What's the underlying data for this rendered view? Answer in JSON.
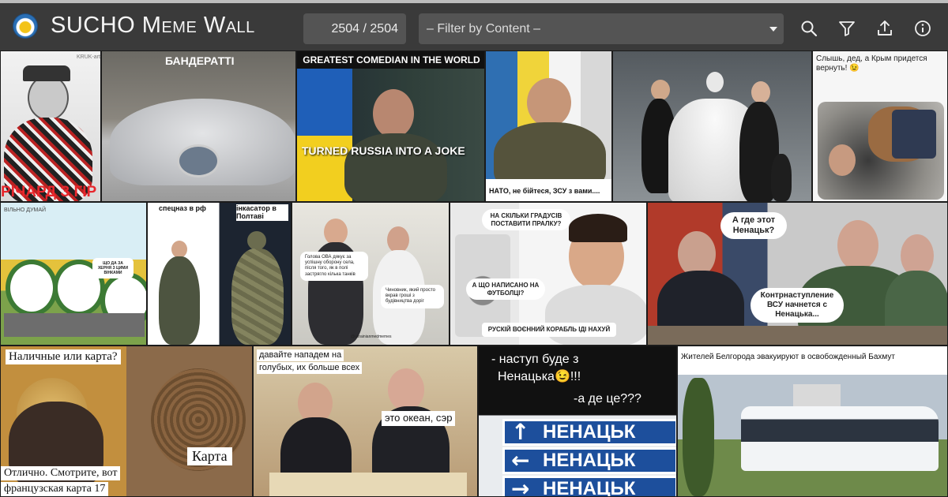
{
  "app": {
    "title": "SUCHO Meme Wall",
    "counter": "2504 / 2504",
    "filter_placeholder": "– Filter by Content –"
  },
  "toolbar": {
    "icons": [
      "search-icon",
      "filter-icon",
      "share-icon",
      "info-icon"
    ]
  },
  "memes": {
    "m1": {
      "caption": "РІЧАРД З ГІР",
      "watermark": "KRUK-art"
    },
    "m2": {
      "caption": "БАНДЕРАТТІ"
    },
    "m3": {
      "top": "GREATEST COMEDIAN IN THE WORLD",
      "bottom": "TURNED RUSSIA INTO A JOKE"
    },
    "m4": {
      "caption": "НАТО, не бійтеся, ЗСУ з вами...."
    },
    "m6": {
      "caption": "Слышь, дед, а Крым придется вернуть! 😉"
    },
    "m7": {
      "bubble": "ЩО ДА ЗА ХЕРНЯ З ЦИМИ ВІНКАМИ",
      "tag": "ВІЛЬНО ДУМАЙ"
    },
    "m8": {
      "left": "спецназ в рф",
      "right": "інкасатор в Полтаві"
    },
    "m9": {
      "bubble1": "Голова ОВА дякує за успішну оборону села, після того, як в полі застрягло кілька танків",
      "bubble2": "Чиновник, який просто вкрав гроші з будівництва доріг",
      "footer": "@ukrainianmedmemes"
    },
    "m10": {
      "bubble1": "НА СКІЛЬКИ ГРАДУСІВ ПОСТАВИТИ ПРАЛКУ?",
      "bubble2": "А ЩО НАПИСАНО НА ФУТБОЛЦІ?",
      "bubble3": "РУСКІЙ ВОЄННИЙ КОРАБЛЬ ІДІ НАХУЙ"
    },
    "m11": {
      "bubble1": "А где этот Ненацьк?",
      "bubble2": "Контрнаступление ВСУ начнется с Ненацька..."
    },
    "m12": {
      "top": "Наличные или карта?",
      "middle": "Карта",
      "bottom1": "Отлично. Смотрите, вот",
      "bottom2": "французская карта 17"
    },
    "m13": {
      "top1": "давайте нападем на",
      "top2": "голубых, их больше всех",
      "right": "это океан, сэр"
    },
    "m14": {
      "line1": "- наступ буде з",
      "line2": "Ненацька😉!!!",
      "line3": "-а де це???",
      "sign1": "НЕНАЦЬК",
      "sign2": "НЕНАЦЬК",
      "sign3": "НЕНАЦЬК"
    },
    "m15": {
      "caption": "Жителей Белгорода эвакуируют в освобожденный Бахмут"
    }
  },
  "colors": {
    "topbar": "#3a3a3a",
    "field": "#545454",
    "sign_blue": "#1d4f9c",
    "caption_red": "#e8262c"
  }
}
